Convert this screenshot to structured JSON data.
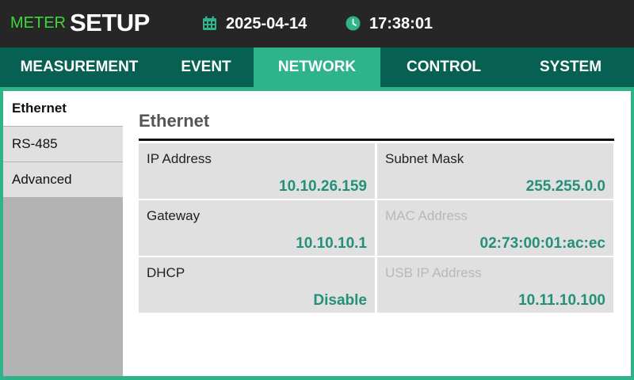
{
  "header": {
    "brand_meter": "METER",
    "brand_setup": "SETUP",
    "date": "2025-04-14",
    "time": "17:38:01",
    "date_icon": "calendar-icon",
    "time_icon": "clock-icon"
  },
  "tabs": [
    {
      "label": "MEASUREMENT",
      "active": false
    },
    {
      "label": "EVENT",
      "active": false
    },
    {
      "label": "NETWORK",
      "active": true
    },
    {
      "label": "CONTROL",
      "active": false
    },
    {
      "label": "SYSTEM",
      "active": false
    }
  ],
  "sidebar": {
    "items": [
      {
        "label": "Ethernet",
        "active": true
      },
      {
        "label": "RS-485",
        "active": false
      },
      {
        "label": "Advanced",
        "active": false
      }
    ]
  },
  "main": {
    "title": "Ethernet",
    "fields": [
      {
        "label": "IP Address",
        "value": "10.10.26.159",
        "editable": true
      },
      {
        "label": "Subnet Mask",
        "value": "255.255.0.0",
        "editable": true
      },
      {
        "label": "Gateway",
        "value": "10.10.10.1",
        "editable": true
      },
      {
        "label": "MAC Address",
        "value": "02:73:00:01:ac:ec",
        "editable": false
      },
      {
        "label": "DHCP",
        "value": "Disable",
        "editable": true
      },
      {
        "label": "USB IP Address",
        "value": "10.11.10.100",
        "editable": false
      }
    ]
  },
  "colors": {
    "accent": "#2fb38a",
    "tab_bar": "#066152",
    "topbar": "#262626",
    "brand_green": "#3fd63a",
    "value_text": "#25907a",
    "cell_bg": "#e0e0e0",
    "sidebar_bg": "#b3b3b3"
  }
}
